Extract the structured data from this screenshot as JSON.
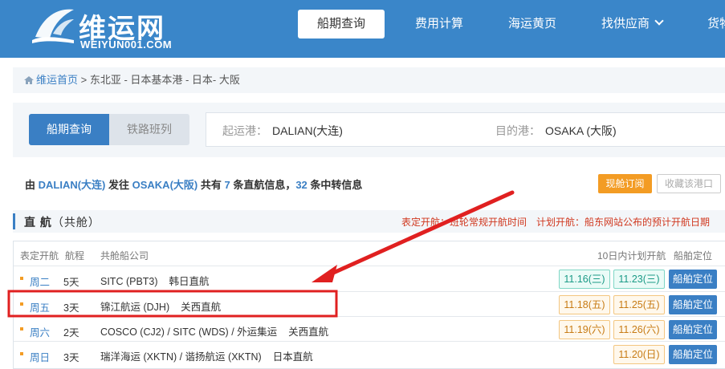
{
  "header": {
    "logo_text": "维运网",
    "logo_sub": "WEIYUN001.COM",
    "nav": [
      "船期查询",
      "费用计算",
      "海运黄页",
      "找供应商",
      "货物跟"
    ]
  },
  "breadcrumb": {
    "home": "维运首页",
    "path": " > 东北亚 - 日本基本港 - 日本- 大阪"
  },
  "search": {
    "tabs": [
      "船期查询",
      "铁路班列"
    ],
    "origin_label": "起运港：",
    "origin_value": "DALIAN(大连)",
    "dest_label": "目的港：",
    "dest_value": "OSAKA (大阪)"
  },
  "summary": {
    "p1": "由 ",
    "origin": "DALIAN(大连)",
    "p2": " 发往 ",
    "dest": "OSAKA(大阪)",
    "p3": " 共有 ",
    "direct_count": "7",
    "p4": " 条直航信息，",
    "transfer_count": "32",
    "p5": " 条中转信息",
    "subscribe_btn": "现舱订阅",
    "favorite_btn": "收藏该港口"
  },
  "section": {
    "title": "直 航",
    "sub": "（共舱）",
    "legend1": "表定开航：班轮常规开航时间",
    "legend2": "计划开航：船东网站公布的预计开航日期"
  },
  "table": {
    "headers": {
      "scheduled": "表定开航",
      "duration": "航程",
      "carrier": "共舱船公司",
      "planned": "10日内计划开航",
      "locate": "船舶定位"
    },
    "rows": [
      {
        "day": "周二",
        "duration": "5天",
        "carrier": "SITC (PBT3)",
        "route": "韩日直航",
        "dates": [
          "11.16(三)",
          "11.23(三)"
        ],
        "date_style": "green",
        "btn": "船舶定位"
      },
      {
        "day": "周五",
        "duration": "3天",
        "carrier": "锦江航运 (DJH)",
        "route": "关西直航",
        "dates": [
          "11.18(五)",
          "11.25(五)"
        ],
        "date_style": "orange",
        "btn": "船舶定位"
      },
      {
        "day": "周六",
        "duration": "2天",
        "carrier": "COSCO (CJ2) / SITC (WDS) / 外运集运",
        "route": "关西直航",
        "dates": [
          "11.19(六)",
          "11.26(六)"
        ],
        "date_style": "orange",
        "btn": "船舶定位"
      },
      {
        "day": "周日",
        "duration": "3天",
        "carrier": "瑞洋海运 (XKTN) / 谐扬航运 (XKTN)",
        "route": "日本直航",
        "dates": [
          "11.20(日)"
        ],
        "date_style": "orange",
        "btn": "船舶定位"
      }
    ]
  },
  "colors": {
    "brand": "#3a86c9",
    "accent_orange": "#f39c24",
    "annotation_red": "#e02020"
  }
}
